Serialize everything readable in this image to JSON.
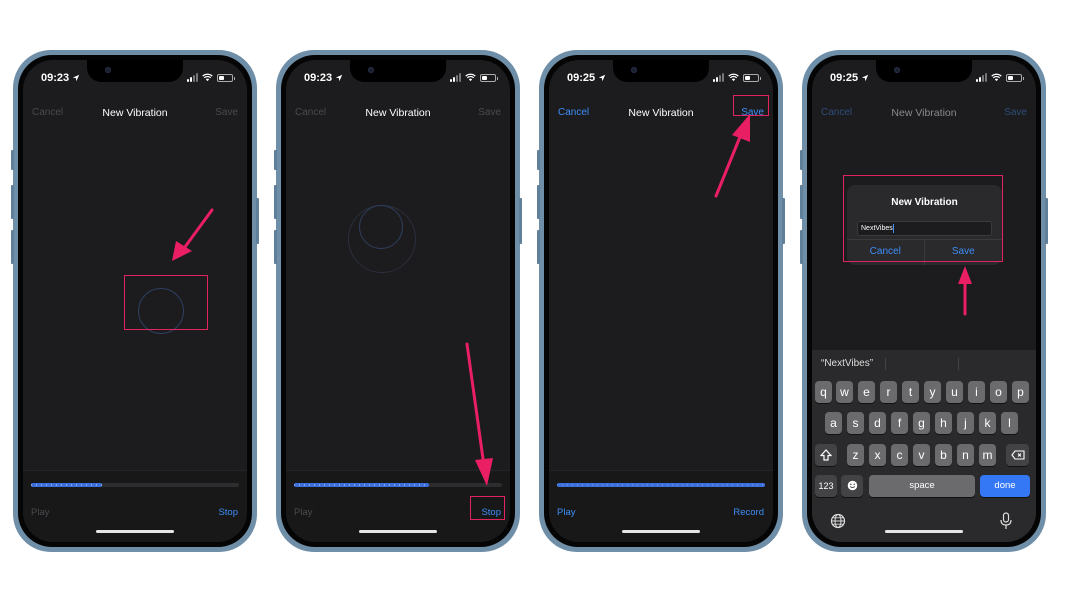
{
  "phones": [
    {
      "time": "09:23",
      "nav": {
        "cancel": "Cancel",
        "title": "New Vibration",
        "save": "Save"
      },
      "bottom": {
        "left": "Play",
        "right": "Stop"
      },
      "progress": 0.34
    },
    {
      "time": "09:23",
      "nav": {
        "cancel": "Cancel",
        "title": "New Vibration",
        "save": "Save"
      },
      "bottom": {
        "left": "Play",
        "right": "Stop"
      },
      "progress": 0.65
    },
    {
      "time": "09:25",
      "nav": {
        "cancel": "Cancel",
        "title": "New Vibration",
        "save": "Save"
      },
      "bottom": {
        "left": "Play",
        "right": "Record"
      },
      "progress": 1.0
    },
    {
      "time": "09:25",
      "nav": {
        "cancel": "Cancel",
        "title": "New Vibration",
        "save": "Save"
      },
      "dialog": {
        "title": "New Vibration",
        "input_value": "NextVibes",
        "cancel": "Cancel",
        "save": "Save"
      },
      "keyboard": {
        "suggestion": "“NextVibes”",
        "row1": [
          "q",
          "w",
          "e",
          "r",
          "t",
          "y",
          "u",
          "i",
          "o",
          "p"
        ],
        "row2": [
          "a",
          "s",
          "d",
          "f",
          "g",
          "h",
          "j",
          "k",
          "l"
        ],
        "row3": [
          "z",
          "x",
          "c",
          "v",
          "b",
          "n",
          "m"
        ],
        "numbers_key": "123",
        "space_key": "space",
        "done_key": "done"
      }
    }
  ],
  "colors": {
    "accent": "#3e8ef7",
    "highlight": "#e0245e",
    "screen_bg": "#1c1c1e",
    "frame": "#6f8ea8"
  },
  "icons": [
    "location-arrow-icon",
    "signal-icon",
    "wifi-icon",
    "battery-icon",
    "shift-icon",
    "backspace-icon",
    "emoji-icon",
    "globe-icon",
    "microphone-icon",
    "arrow-icon"
  ]
}
